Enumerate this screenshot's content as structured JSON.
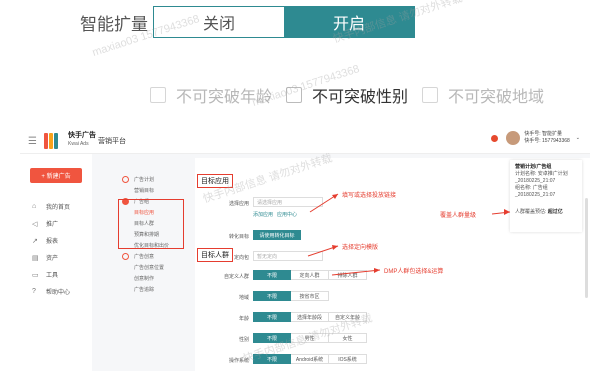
{
  "top_toggle": {
    "label": "智能扩量",
    "off_label": "关闭",
    "on_label": "开启",
    "accent": "#2e8a91"
  },
  "checkboxes": [
    {
      "label": "不可突破年龄",
      "dim": true
    },
    {
      "label": "不可突破性别",
      "dim": false
    },
    {
      "label": "不可突破地域",
      "dim": true
    }
  ],
  "header": {
    "brand_name": "快手广告",
    "brand_sub": "Kwai Ads",
    "platform": "营销平台",
    "account_line1": "快手号: 智能扩量",
    "account_line2": "快手号: 1577943368"
  },
  "sidebar": {
    "new_button": "+ 新建广告",
    "items": [
      {
        "icon": "home-icon",
        "label": "我的首页"
      },
      {
        "icon": "megaphone-icon",
        "label": "推广"
      },
      {
        "icon": "chart-icon",
        "label": "报表"
      },
      {
        "icon": "asset-icon",
        "label": "资产"
      },
      {
        "icon": "tool-icon",
        "label": "工具"
      },
      {
        "icon": "help-icon",
        "label": "帮助中心"
      }
    ]
  },
  "steps": [
    {
      "label": "广告计划",
      "type": "dot"
    },
    {
      "label": "营销目标",
      "type": "sub"
    },
    {
      "label": "广告组",
      "type": "dotfill"
    },
    {
      "label": "目标应用",
      "type": "sub-active"
    },
    {
      "label": "目标人群",
      "type": "sub"
    },
    {
      "label": "预算和排期",
      "type": "sub"
    },
    {
      "label": "优化目标和出价",
      "type": "sub"
    },
    {
      "label": "广告创意",
      "type": "dot"
    },
    {
      "label": "广告创意位置",
      "type": "sub"
    },
    {
      "label": "创意制作",
      "type": "sub"
    },
    {
      "label": "广告追踪",
      "type": "sub"
    }
  ],
  "form": {
    "section_app": "目标应用",
    "app_label": "选择应用",
    "app_placeholder": "请选择应用",
    "add_app_link": "添加应用",
    "app_center_link": "应用中心",
    "convert_label": "转化目标",
    "convert_button": "请使用转化目标",
    "section_audience": "目标人群",
    "pack_label": "定向包",
    "pack_placeholder": "暂无定向",
    "custom_label": "自定义人群",
    "custom_options": [
      "不限",
      "定向人群",
      "排除人群"
    ],
    "region_label": "地域",
    "region_options": [
      "不限",
      "按省市区"
    ],
    "age_label": "年龄",
    "age_options": [
      "不限",
      "选择年龄段",
      "自定义年龄"
    ],
    "gender_label": "性别",
    "gender_options": [
      "不限",
      "男性",
      "女性"
    ],
    "os_label": "操作系统",
    "os_options": [
      "不限",
      "Android系统",
      "IOS系统"
    ]
  },
  "right_card": {
    "title": "营销计划/广告组",
    "line1": "计划名称: 安卓推广计划",
    "line2": "_20180225_21:07",
    "line3": "组名称: 广告组",
    "line4": "_20180225_21:07",
    "metric_label": "人群覆盖预估:",
    "metric_value": "超过亿"
  },
  "annotations": {
    "fill_link": "填写或选择投放链接",
    "cover": "覆盖人群量级",
    "select_pack": "选择定向模版",
    "dmp": "DMP人群包选择&运算"
  },
  "watermarks": [
    "快手内部信息 请勿对外转载",
    "maxiao03 1577943368"
  ]
}
